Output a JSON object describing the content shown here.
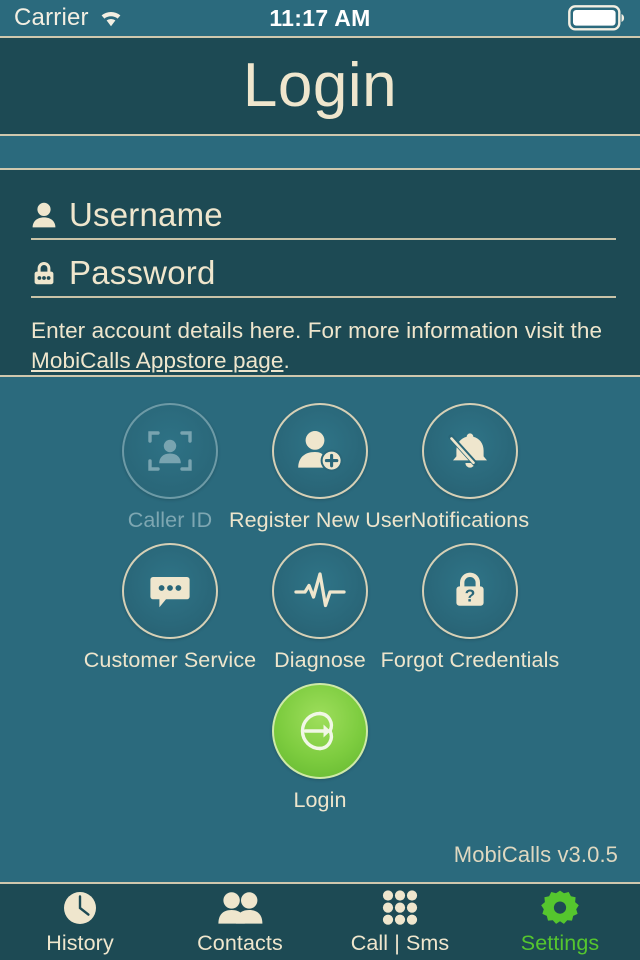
{
  "status_bar": {
    "carrier": "Carrier",
    "wifi_icon": "wifi-icon",
    "time": "11:17 AM",
    "battery_icon": "battery-full-icon"
  },
  "header": {
    "title": "Login"
  },
  "form": {
    "username": {
      "label": "Username",
      "placeholder": "Username",
      "value": "",
      "icon": "user-icon"
    },
    "password": {
      "label": "Password",
      "placeholder": "Password",
      "value": "",
      "icon": "lock-icon"
    },
    "hint_before": "Enter account details here. For more information visit the ",
    "hint_link": "MobiCalls Appstore page",
    "hint_after": "."
  },
  "actions": {
    "rows": [
      [
        {
          "label": "Caller ID",
          "icon": "caller-id-icon",
          "enabled": false
        },
        {
          "label": "Register New User",
          "icon": "user-add-icon",
          "enabled": true
        },
        {
          "label": "Notifications",
          "icon": "bell-muted-icon",
          "enabled": true
        }
      ],
      [
        {
          "label": "Customer Service",
          "icon": "chat-bubble-icon",
          "enabled": true
        },
        {
          "label": "Diagnose",
          "icon": "pulse-icon",
          "enabled": true
        },
        {
          "label": "Forgot Credentials",
          "icon": "lock-question-icon",
          "enabled": true
        }
      ]
    ],
    "login": {
      "label": "Login",
      "icon": "sign-in-arrow-icon"
    }
  },
  "version_text": "MobiCalls v3.0.5",
  "tabs": [
    {
      "label": "History",
      "icon": "clock-icon",
      "active": false
    },
    {
      "label": "Contacts",
      "icon": "people-icon",
      "active": false
    },
    {
      "label": "Call | Sms",
      "icon": "dialpad-icon",
      "active": false
    },
    {
      "label": "Settings",
      "icon": "gear-icon",
      "active": true
    }
  ],
  "colors": {
    "background_dark": "#1d4a54",
    "background_light": "#2b6a7d",
    "cream": "#efe6cd",
    "rule": "#cfc8ae",
    "accent_green": "#7dcc3f",
    "active_tab_green": "#55c62e",
    "disabled": "#7ea7b2"
  }
}
